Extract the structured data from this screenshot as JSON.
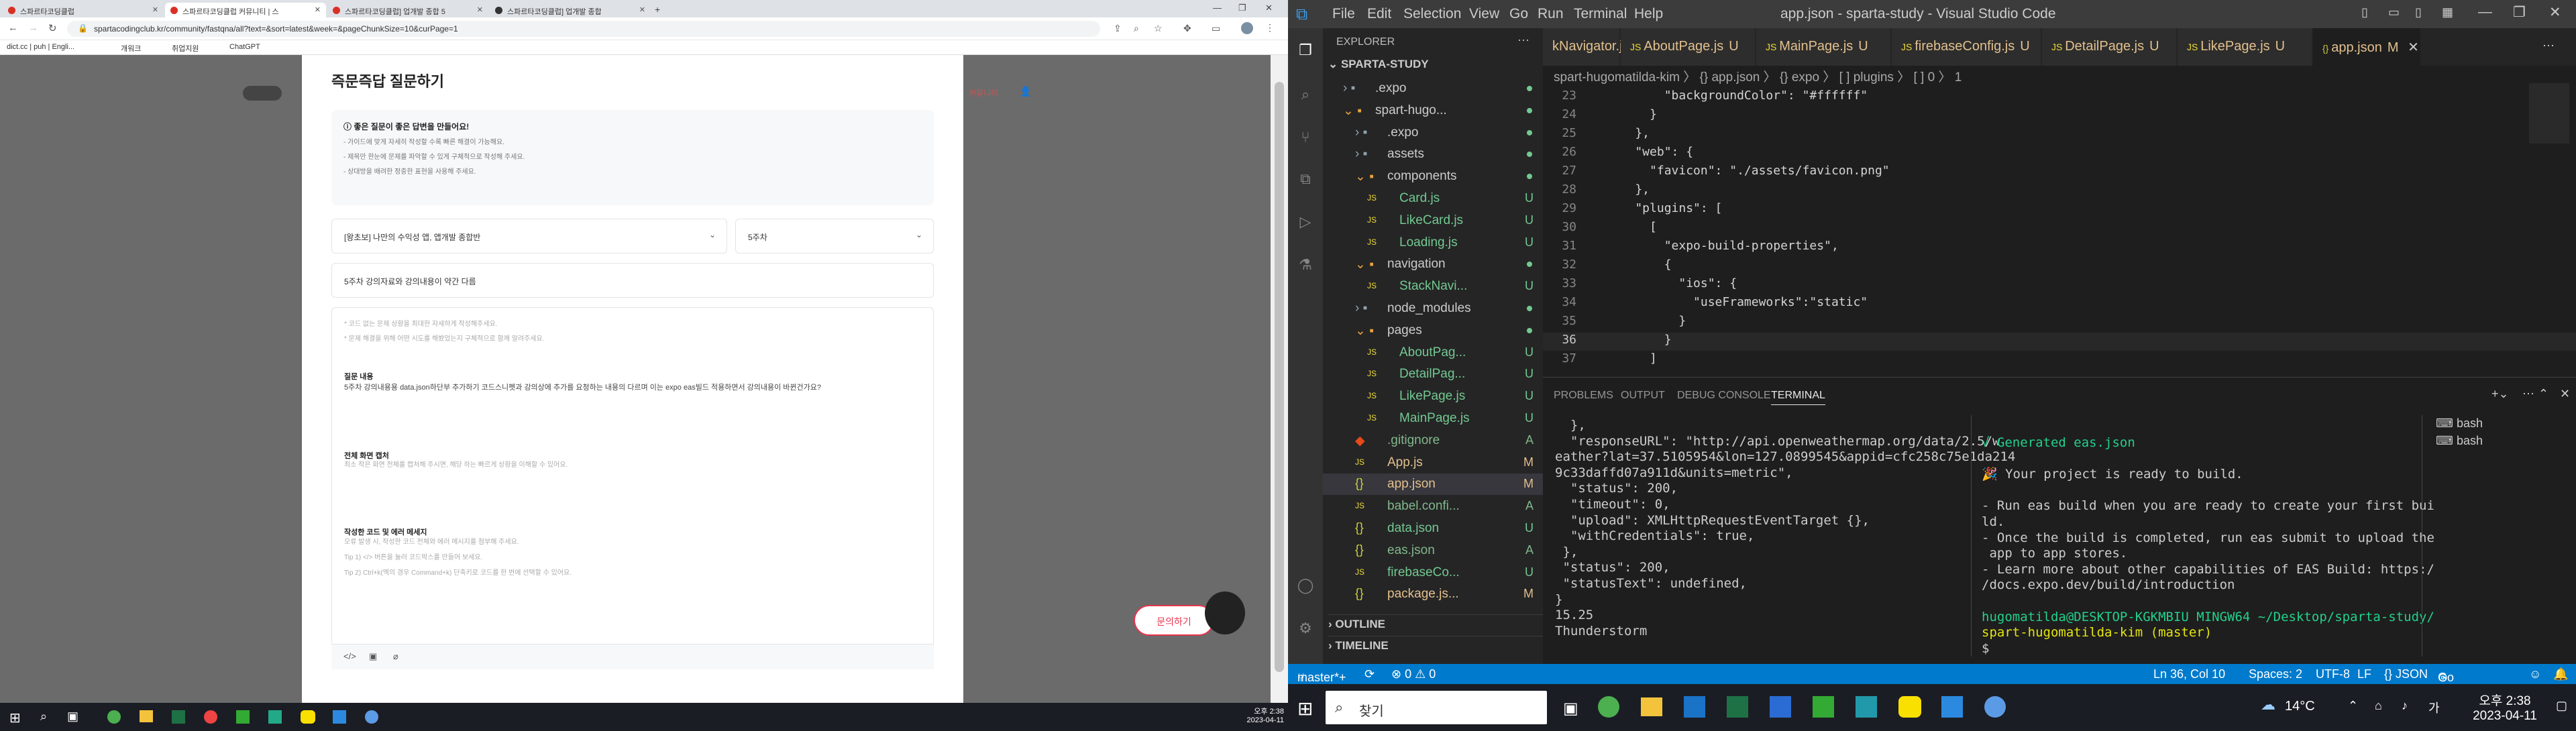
{
  "chrome": {
    "tabs": [
      "스파르타코딩클럽",
      "스파르타코딩클럽 커뮤니티 | 스",
      "스파르타코딩클럽] 업개발 종합 5",
      "스파르타코딩클럽] 업개발 종합"
    ],
    "url": "spartacodingclub.kr/community/fastqna/all?text=&sort=latest&week=&pageChunkSize=10&curPage=1",
    "bookmarks": [
      "dict.cc | puh | Engli...",
      "개워크",
      "취업지원",
      "ChatGPT"
    ]
  },
  "page": {
    "title": "즉문즉답 질문하기",
    "header_right": "커뮤니티",
    "tip_title": "좋은 질문이 좋은 답변을 만들어요!",
    "tips": [
      "- 가이드에 맞게 자세히 작성할 수록 빠른 해결이 가능해요.",
      "- 제목만 한눈에 문제를 파악할 수 있게 구체적으로 작성해 주세요.",
      "- 상대방을 배려한 정중한 표현을 사용해 주세요."
    ],
    "course_select": "[왕초보] 나만의 수익성 앱, 앱개발 종합반",
    "week_select": "5주차",
    "title_value": "5주차 강의자료와 강의내용이 약간 다름",
    "hints": [
      "* 코드 없는 문제 상황을 최대한 자세하게 작성해주세요.",
      "* 문제 해결을 위해 어떤 시도를 해봤었는지 구체적으로 함께 알려주세요."
    ],
    "q_label": "질문 내용",
    "q_text": "5주차 강의내용용 data.json하단부 추가하기 코드스니펫과 강의상에 추가를 요청하는 내용의 다르며 이는 expo eas빌드 적용하면서 강의내용이 바뀐건가요?",
    "screen_label": "전체 화면 캡처",
    "screen_hint": "최소 작은 화면 전체를 캡처해 주시면, 해당 하는 빠르게 상황을 이해할 수 있어요.",
    "code_label": "작성한 코드 및 에러 메세지",
    "code_hints": [
      "오류 발생 시, 작성한 코드 전체와 에러 메시지를 첨부해 주세요.",
      "Tip 1) </> 버튼을 눌러 코드박스를 만들어 보세요.",
      "Tip 2) Ctrl+k(맥의 경우 Command+k) 단축키로 코드를 한 번에 선택할 수 있어요."
    ],
    "ask_button": "문의하기"
  },
  "vscode": {
    "window_title": "app.json - sparta-study - Visual Studio Code",
    "menu": [
      "File",
      "Edit",
      "Selection",
      "View",
      "Go",
      "Run",
      "Terminal",
      "Help"
    ],
    "explorer_title": "EXPLORER",
    "root": "SPARTA-STUDY",
    "tree": [
      {
        "name": ".expo",
        "status": "",
        "indent": 1,
        "kind": "folder"
      },
      {
        "name": "spart-hugo...",
        "status": "",
        "indent": 1,
        "kind": "folder-open"
      },
      {
        "name": ".expo",
        "status": "",
        "indent": 2,
        "kind": "folder"
      },
      {
        "name": "assets",
        "status": "",
        "indent": 2,
        "kind": "folder"
      },
      {
        "name": "components",
        "status": "",
        "indent": 2,
        "kind": "folder-open"
      },
      {
        "name": "Card.js",
        "status": "U",
        "indent": 3,
        "kind": "js"
      },
      {
        "name": "LikeCard.js",
        "status": "U",
        "indent": 3,
        "kind": "js"
      },
      {
        "name": "Loading.js",
        "status": "U",
        "indent": 3,
        "kind": "js"
      },
      {
        "name": "navigation",
        "status": "",
        "indent": 2,
        "kind": "folder-open"
      },
      {
        "name": "StackNavi...",
        "status": "U",
        "indent": 3,
        "kind": "js"
      },
      {
        "name": "node_modules",
        "status": "",
        "indent": 2,
        "kind": "folder"
      },
      {
        "name": "pages",
        "status": "",
        "indent": 2,
        "kind": "folder-open"
      },
      {
        "name": "AboutPag...",
        "status": "U",
        "indent": 3,
        "kind": "js"
      },
      {
        "name": "DetailPag...",
        "status": "U",
        "indent": 3,
        "kind": "js"
      },
      {
        "name": "LikePage.js",
        "status": "U",
        "indent": 3,
        "kind": "js"
      },
      {
        "name": "MainPage.js",
        "status": "U",
        "indent": 3,
        "kind": "js"
      },
      {
        "name": ".gitignore",
        "status": "A",
        "indent": 2,
        "kind": "git"
      },
      {
        "name": "App.js",
        "status": "M",
        "indent": 2,
        "kind": "js"
      },
      {
        "name": "app.json",
        "status": "M",
        "indent": 2,
        "kind": "json"
      },
      {
        "name": "babel.confi...",
        "status": "A",
        "indent": 2,
        "kind": "js"
      },
      {
        "name": "data.json",
        "status": "U",
        "indent": 2,
        "kind": "json"
      },
      {
        "name": "eas.json",
        "status": "A",
        "indent": 2,
        "kind": "json"
      },
      {
        "name": "firebaseCo...",
        "status": "U",
        "indent": 2,
        "kind": "js"
      },
      {
        "name": "package.js...",
        "status": "M",
        "indent": 2,
        "kind": "json"
      }
    ],
    "outline": "OUTLINE",
    "timeline": "TIMELINE",
    "editor_tabs": [
      {
        "name": "kNavigator.js",
        "status": "U"
      },
      {
        "name": "AboutPage.js",
        "status": "U"
      },
      {
        "name": "MainPage.js",
        "status": "U"
      },
      {
        "name": "firebaseConfig.js",
        "status": "U"
      },
      {
        "name": "DetailPage.js",
        "status": "U"
      },
      {
        "name": "LikePage.js",
        "status": "U"
      },
      {
        "name": "app.json",
        "status": "M"
      }
    ],
    "breadcrumb": "spart-hugomatilda-kim 〉 {} app.json 〉 {} expo 〉 [ ] plugins 〉 [ ] 0 〉 1",
    "code_lines": [
      {
        "n": "23",
        "t": "        \"backgroundColor\": \"#ffffff\""
      },
      {
        "n": "24",
        "t": "      }"
      },
      {
        "n": "25",
        "t": "    },"
      },
      {
        "n": "26",
        "t": "    \"web\": {"
      },
      {
        "n": "27",
        "t": "      \"favicon\": \"./assets/favicon.png\""
      },
      {
        "n": "28",
        "t": "    },"
      },
      {
        "n": "29",
        "t": "    \"plugins\": ["
      },
      {
        "n": "30",
        "t": "      ["
      },
      {
        "n": "31",
        "t": "        \"expo-build-properties\","
      },
      {
        "n": "32",
        "t": "        {"
      },
      {
        "n": "33",
        "t": "          \"ios\": {"
      },
      {
        "n": "34",
        "t": "            \"useFrameworks\":\"static\""
      },
      {
        "n": "35",
        "t": "          }"
      },
      {
        "n": "36",
        "t": "        }"
      },
      {
        "n": "37",
        "t": "      ]"
      }
    ],
    "panel_tabs": [
      "PROBLEMS",
      "OUTPUT",
      "DEBUG CONSOLE",
      "TERMINAL"
    ],
    "term_left": [
      "  },",
      "  \"responseURL\": \"http://api.openweathermap.org/data/2.5/w",
      "eather?lat=37.5105954&lon=127.0899545&appid=cfc258c75e1da214",
      "9c33daffd07a911d&units=metric\",",
      "  \"status\": 200,",
      "  \"timeout\": 0,",
      "  \"upload\": XMLHttpRequestEventTarget {},",
      "  \"withCredentials\": true,",
      " },",
      " \"status\": 200,",
      " \"statusText\": undefined,",
      "}",
      "15.25",
      "Thunderstorm",
      ""
    ],
    "term_right": [
      "√ Generated eas.json",
      "",
      "🎉 Your project is ready to build.",
      "",
      "- Run eas build when you are ready to create your first bui",
      "ld.",
      "- Once the build is completed, run eas submit to upload the",
      " app to app stores.",
      "- Learn more about other capabilities of EAS Build: https:/",
      "/docs.expo.dev/build/introduction",
      "",
      "hugomatilda@DESKTOP-KGKMBIU MINGW64 ~/Desktop/sparta-study/",
      "spart-hugomatilda-kim (master)",
      "$ "
    ],
    "term_list": [
      "bash",
      "bash"
    ],
    "status_left": [
      "master*+",
      "⊗ 0 ⚠ 0"
    ],
    "status_right": [
      "Ln 36, Col 10",
      "Spaces: 2",
      "UTF-8",
      "LF",
      "{} JSON",
      "Go Live"
    ]
  },
  "taskbar": {
    "left_time": "오후 2:38",
    "left_date": "2023-04-11",
    "search": "찾기",
    "weather": "14°C",
    "right_time": "오후 2:38",
    "right_date": "2023-04-11"
  }
}
